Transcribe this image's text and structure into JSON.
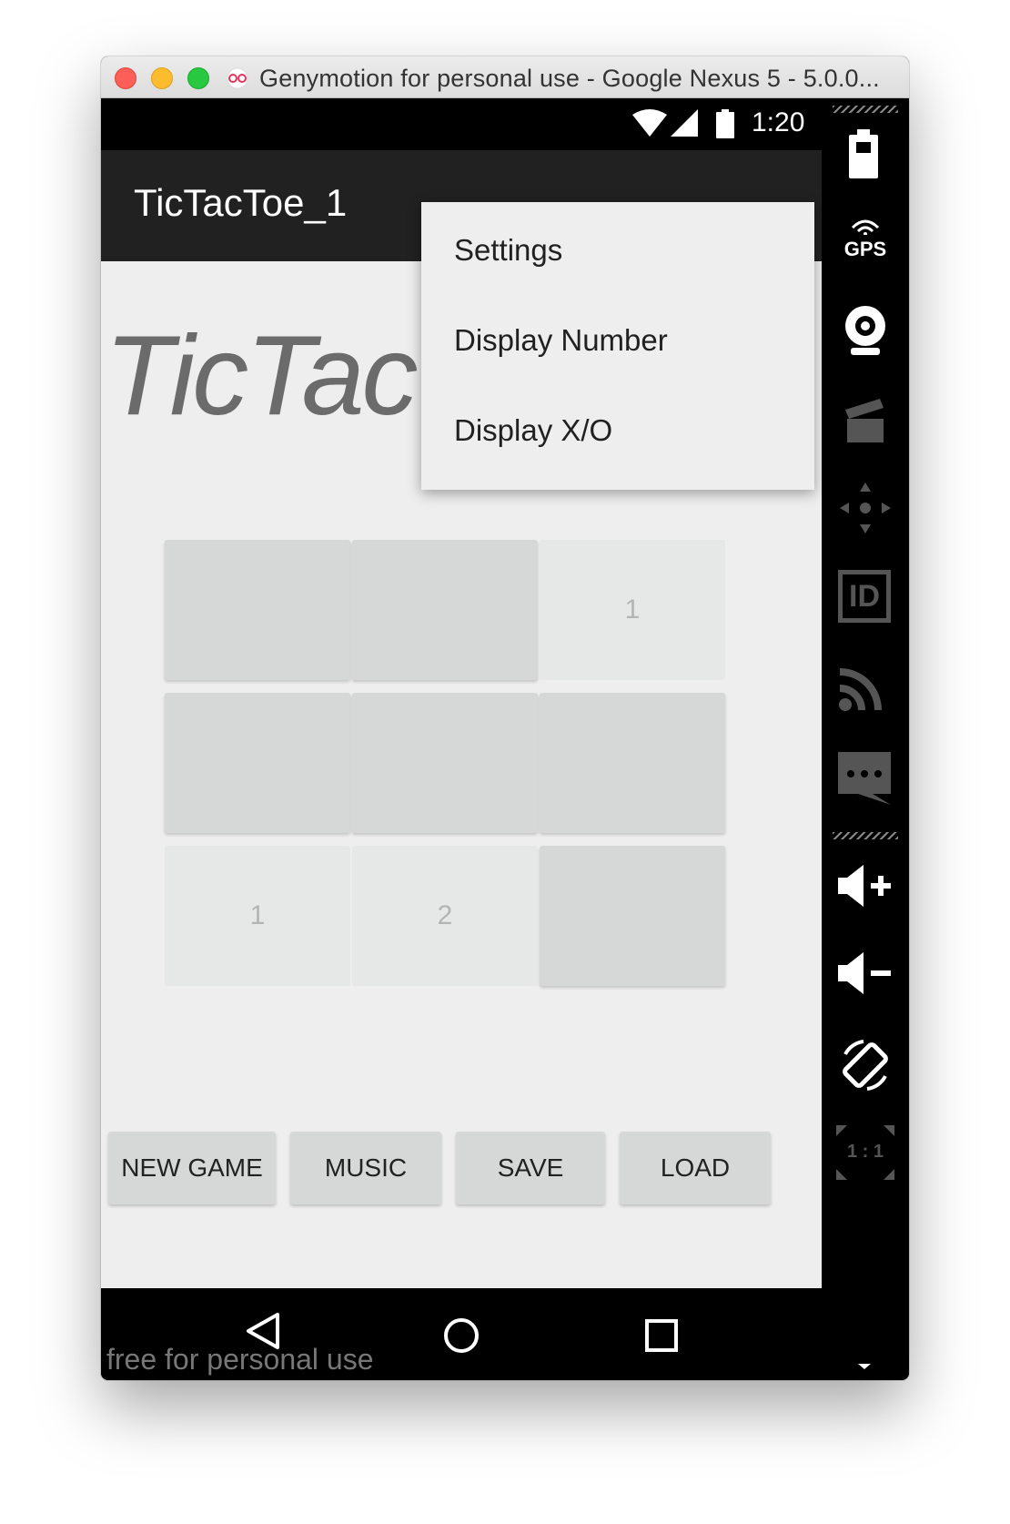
{
  "window": {
    "title": "Genymotion for personal use - Google Nexus 5 - 5.0.0..."
  },
  "status_bar": {
    "time": "1:20"
  },
  "app": {
    "title": "TicTacToe_1",
    "banner": "TicTac"
  },
  "board": {
    "cells": [
      "",
      "",
      "1",
      "",
      "",
      "",
      "1",
      "2",
      ""
    ]
  },
  "buttons": {
    "new_game": "NEW GAME",
    "music": "MUSIC",
    "save": "SAVE",
    "load": "LOAD"
  },
  "menu": {
    "items": [
      "Settings",
      "Display Number",
      "Display X/O"
    ]
  },
  "watermark": "free for personal use",
  "sidebar": {
    "gps_label": "GPS",
    "id_label": "ID",
    "scale_label": "1 : 1"
  },
  "colors": {
    "action_bar": "#212121",
    "content_bg": "#eeeeee",
    "cell_empty": "#d6d7d7",
    "cell_played": "#e6e7e7"
  },
  "icons": [
    "wifi-icon",
    "signal-icon",
    "battery-icon",
    "back-icon",
    "home-icon",
    "recents-icon",
    "gps-icon",
    "webcam-icon",
    "clapperboard-icon",
    "dpad-icon",
    "id-icon",
    "cast-icon",
    "sms-icon",
    "volume-up-icon",
    "volume-down-icon",
    "rotate-icon",
    "scale-icon"
  ]
}
